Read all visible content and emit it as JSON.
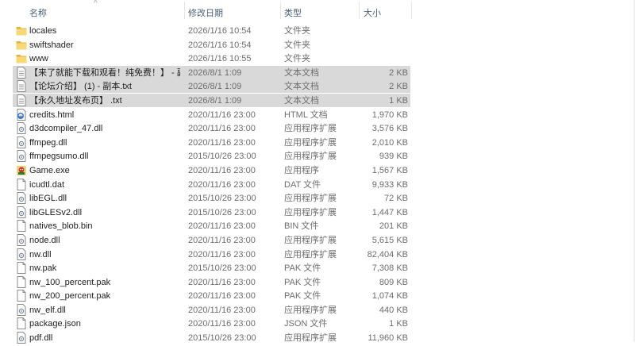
{
  "header": {
    "col_name": "名称",
    "col_date": "修改日期",
    "col_type": "类型",
    "col_size": "大小",
    "sort_indicator": "^"
  },
  "files": [
    {
      "name": "locales",
      "date": "2026/1/16 10:54",
      "type": "文件夹",
      "size": "",
      "icon": "folder-icon",
      "selected": false
    },
    {
      "name": "swiftshader",
      "date": "2026/1/16 10:54",
      "type": "文件夹",
      "size": "",
      "icon": "folder-icon",
      "selected": false
    },
    {
      "name": "www",
      "date": "2026/1/16 10:55",
      "type": "文件夹",
      "size": "",
      "icon": "folder-icon",
      "selected": false
    },
    {
      "name": "【来了就能下载和观看！纯免费！】 - 副...",
      "date": "2026/8/1 1:09",
      "type": "文本文档",
      "size": "2 KB",
      "icon": "text-file-icon",
      "selected": true
    },
    {
      "name": "【论坛介绍】 (1) - 副本.txt",
      "date": "2026/8/1 1:09",
      "type": "文本文档",
      "size": "2 KB",
      "icon": "text-file-icon",
      "selected": true
    },
    {
      "name": "【永久地址发布页】 .txt",
      "date": "2026/8/1 1:09",
      "type": "文本文档",
      "size": "1 KB",
      "icon": "text-file-icon",
      "selected": true
    },
    {
      "name": "credits.html",
      "date": "2020/11/16 23:00",
      "type": "HTML 文档",
      "size": "1,970 KB",
      "icon": "html-file-icon",
      "selected": false
    },
    {
      "name": "d3dcompiler_47.dll",
      "date": "2020/11/16 23:00",
      "type": "应用程序扩展",
      "size": "3,576 KB",
      "icon": "dll-file-icon",
      "selected": false
    },
    {
      "name": "ffmpeg.dll",
      "date": "2020/11/16 23:00",
      "type": "应用程序扩展",
      "size": "2,010 KB",
      "icon": "dll-file-icon",
      "selected": false
    },
    {
      "name": "ffmpegsumo.dll",
      "date": "2015/10/26 23:00",
      "type": "应用程序扩展",
      "size": "939 KB",
      "icon": "dll-file-icon",
      "selected": false
    },
    {
      "name": "Game.exe",
      "date": "2020/11/16 23:00",
      "type": "应用程序",
      "size": "1,567 KB",
      "icon": "game-exe-icon",
      "selected": false
    },
    {
      "name": "icudtl.dat",
      "date": "2020/11/16 23:00",
      "type": "DAT 文件",
      "size": "9,933 KB",
      "icon": "generic-file-icon",
      "selected": false
    },
    {
      "name": "libEGL.dll",
      "date": "2015/10/26 23:00",
      "type": "应用程序扩展",
      "size": "72 KB",
      "icon": "dll-file-icon",
      "selected": false
    },
    {
      "name": "libGLESv2.dll",
      "date": "2015/10/26 23:00",
      "type": "应用程序扩展",
      "size": "1,447 KB",
      "icon": "dll-file-icon",
      "selected": false
    },
    {
      "name": "natives_blob.bin",
      "date": "2020/11/16 23:00",
      "type": "BIN 文件",
      "size": "201 KB",
      "icon": "generic-file-icon",
      "selected": false
    },
    {
      "name": "node.dll",
      "date": "2020/11/16 23:00",
      "type": "应用程序扩展",
      "size": "5,615 KB",
      "icon": "dll-file-icon",
      "selected": false
    },
    {
      "name": "nw.dll",
      "date": "2020/11/16 23:00",
      "type": "应用程序扩展",
      "size": "82,404 KB",
      "icon": "dll-file-icon",
      "selected": false
    },
    {
      "name": "nw.pak",
      "date": "2015/10/26 23:00",
      "type": "PAK 文件",
      "size": "7,308 KB",
      "icon": "generic-file-icon",
      "selected": false
    },
    {
      "name": "nw_100_percent.pak",
      "date": "2020/11/16 23:00",
      "type": "PAK 文件",
      "size": "809 KB",
      "icon": "generic-file-icon",
      "selected": false
    },
    {
      "name": "nw_200_percent.pak",
      "date": "2020/11/16 23:00",
      "type": "PAK 文件",
      "size": "1,074 KB",
      "icon": "generic-file-icon",
      "selected": false
    },
    {
      "name": "nw_elf.dll",
      "date": "2020/11/16 23:00",
      "type": "应用程序扩展",
      "size": "440 KB",
      "icon": "dll-file-icon",
      "selected": false
    },
    {
      "name": "package.json",
      "date": "2020/11/16 23:00",
      "type": "JSON 文件",
      "size": "1 KB",
      "icon": "generic-file-icon",
      "selected": false
    },
    {
      "name": "pdf.dll",
      "date": "2015/10/26 23:00",
      "type": "应用程序扩展",
      "size": "11,960 KB",
      "icon": "dll-file-icon",
      "selected": false
    }
  ],
  "colors": {
    "header_text": "#4c607a",
    "selection": "#d9d9d9",
    "folder": "#f8d775",
    "folder_dark": "#e8b23a"
  }
}
